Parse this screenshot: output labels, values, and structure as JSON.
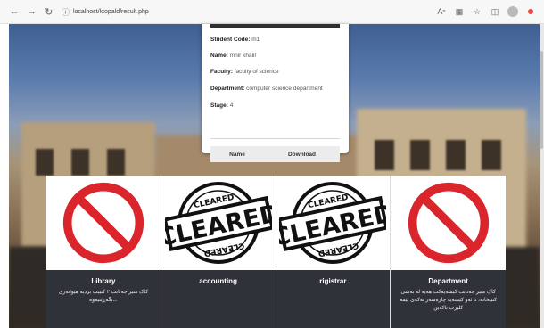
{
  "browser": {
    "url": "localhost/ktopald/result.php",
    "icons": [
      "back-icon",
      "forward-icon",
      "reload-icon",
      "info-icon",
      "read-aloud-icon",
      "extensions-icon",
      "favorites-icon",
      "collections-icon",
      "profile-icon"
    ]
  },
  "student": {
    "code_label": "Student Code:",
    "code_value": "m1",
    "name_label": "Name:",
    "name_value": "mnir khalil",
    "faculty_label": "Faculty:",
    "faculty_value": "faculty of science",
    "department_label": "Department:",
    "department_value": "computer science department",
    "stage_label": "Stage:",
    "stage_value": "4"
  },
  "table": {
    "col_name": "Name",
    "col_download": "Download"
  },
  "tiles": [
    {
      "title": "Library",
      "status": "not-cleared",
      "message": "کاک منیر جەنابت ٢ کتێبت بردیە هێوانەری  ...بگەڕێنیەوە"
    },
    {
      "title": "accounting",
      "status": "cleared",
      "stamp_top": "CLEARED",
      "stamp_main": "CLEARED",
      "stamp_bottom": "CLEARED",
      "message": ""
    },
    {
      "title": "rigistrar",
      "status": "cleared",
      "stamp_top": "CLEARED",
      "stamp_main": "CLEARED",
      "stamp_bottom": "CLEARED",
      "message": ""
    },
    {
      "title": "Department",
      "status": "not-cleared",
      "message": "کاک منیر جەنابت کێشەیەکت هەیە لە بەشی کتێبخانە، تا ئەو کێشەیە چارەسەر نەکەی ئێمە کلیرت ناکەین"
    }
  ],
  "colors": {
    "prohibit_red": "#d9252b",
    "footer_bg": "#2f3238",
    "stamp": "#111111"
  }
}
